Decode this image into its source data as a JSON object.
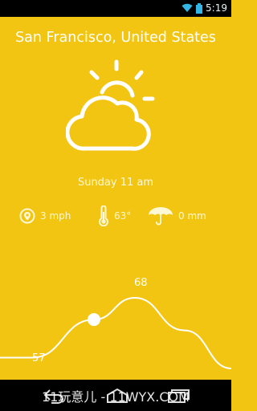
{
  "status_bar": {
    "time": "5:19",
    "icons": [
      "wifi-icon",
      "battery-icon"
    ]
  },
  "weather": {
    "location": "San Francisco, United States",
    "condition_icon": "partly-cloudy-icon",
    "day_time": "Sunday 11 am",
    "wind": "3 mph",
    "temperature": "63°",
    "precipitation": "0 mm"
  },
  "chart_data": {
    "type": "line",
    "x": [
      "",
      "",
      "",
      "",
      "",
      ""
    ],
    "values": [
      57,
      57,
      64,
      68,
      62,
      55
    ],
    "labels": [
      "57",
      "68"
    ],
    "highlight_value": 64
  },
  "nav_bar": {
    "icons": [
      "back-icon",
      "home-icon",
      "recent-apps-icon"
    ],
    "watermark": "11玩意儿 - 11WYX.COM"
  },
  "colors": {
    "background": "#f2c512",
    "text": "#ffffff",
    "bars": "#000000"
  }
}
